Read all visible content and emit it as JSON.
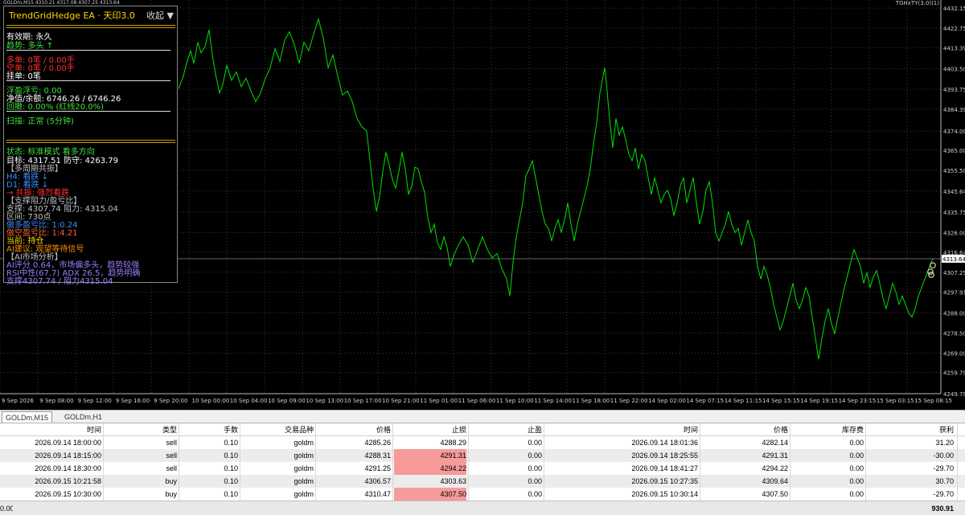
{
  "chart": {
    "symbol_header": "GOLDm,M15  4310.21 4317.08 4307.25 4313.64",
    "indicator_label": "TGHxTY(3.0)(1)",
    "price_label": "4313.64",
    "price_axis": [
      "4432.15",
      "4422.75",
      "4413.39",
      "4403.50",
      "4393.75",
      "4384.39",
      "4374.00",
      "4365.00",
      "4355.50",
      "4345.64",
      "4335.75",
      "4326.00",
      "4316.64",
      "4307.25",
      "4297.91",
      "4288.00",
      "4278.50",
      "4269.00",
      "4259.79",
      "4249.79"
    ],
    "time_axis": [
      "9 Sep 2026",
      "9 Sep 08:00",
      "9 Sep 12:00",
      "9 Sep 16:00",
      "9 Sep 20:00",
      "10 Sep 00:00",
      "10 Sep 04:00",
      "10 Sep 09:00",
      "10 Sep 13:00",
      "10 Sep 17:00",
      "10 Sep 21:00",
      "11 Sep 01:00",
      "11 Sep 06:00",
      "11 Sep 10:00",
      "11 Sep 14:00",
      "11 Sep 18:00",
      "11 Sep 22:00",
      "14 Sep 02:00",
      "14 Sep 07:15",
      "14 Sep 11:15",
      "14 Sep 15:15",
      "14 Sep 19:15",
      "14 Sep 23:15",
      "15 Sep 03:15",
      "15 Sep 08:15"
    ],
    "line_color": "#00e000",
    "grid_color": "#3a3a3a"
  },
  "ea": {
    "title": "TrendGridHedge EA · 天印3.0",
    "collapse": "收起 ▼",
    "validity": "有效期: 永久",
    "trend": "趋势: 多头 ↑",
    "long_orders": "多单: 0笔 / 0.00手",
    "short_orders": "空单: 0笔 / 0.00手",
    "pending": "挂单: 0笔",
    "floating": "浮盈浮亏: 0.00",
    "equity": "净值/余额: 6746.26 / 6746.26",
    "drawdown": "回撤: 0.00% (红线20.0%)",
    "scan": "扫描: 正常 (5分钟)",
    "status": "状态: 标准模式 看多方向",
    "target": "目标: 4317.51  防守: 4263.79",
    "resonance_hdr": "【多周期共振】",
    "h4": "H4: 看跌 ↓",
    "d1": "D1: 看跌 ↓",
    "conclusion": "→ 共振: 强烈看跌",
    "sr_hdr": "【支撑阻力/盈亏比】",
    "sr": "支撑: 4307.74  阻力: 4315.04",
    "range": "区间: 730点",
    "long_rr": "做多盈亏比: 1:0.24",
    "short_rr": "做空盈亏比: 1:4.21",
    "current": "当前: 持仓",
    "ai_advice": "AI建议: 观望等待信号",
    "ai_hdr": "【AI市场分析】",
    "ai_score": "AI评分 0.64，市场偏多头，趋势较强",
    "ai_rsi": "RSI中性(67.7)  ADX 26.5，趋势明确",
    "ai_sr": "支撑4307.74 / 阻力4315.04",
    "colors": {
      "gold": "#ffd700",
      "white": "#ffffff",
      "red": "#ff3030",
      "green": "#40e040",
      "yellow": "#ffd700",
      "blue": "#3b8cff",
      "orange": "#ff8c00",
      "purple": "#9a7cff",
      "gray": "#c0c0c0"
    }
  },
  "tabs": [
    "GOLDm,M15",
    "GOLDm,H1"
  ],
  "table": {
    "headers": [
      "时间",
      "类型",
      "手数",
      "交易品种",
      "价格",
      "止损",
      "止盈",
      "时间",
      "价格",
      "库存费",
      "获利"
    ],
    "rows": [
      {
        "open_time": "2026.09.14 18:00:00",
        "type": "sell",
        "lots": "0.10",
        "symbol": "goldm",
        "price": "4285.26",
        "sl": "4288.29",
        "tp": "0.00",
        "close_time": "2026.09.14 18:01:36",
        "close_price": "4282.14",
        "swap": "0.00",
        "profit": "31.20",
        "sl_hit": false
      },
      {
        "open_time": "2026.09.14 18:15:00",
        "type": "sell",
        "lots": "0.10",
        "symbol": "goldm",
        "price": "4288.31",
        "sl": "4291.31",
        "tp": "0.00",
        "close_time": "2026.09.14 18:25:55",
        "close_price": "4291.31",
        "swap": "0.00",
        "profit": "-30.00",
        "sl_hit": true
      },
      {
        "open_time": "2026.09.14 18:30:00",
        "type": "sell",
        "lots": "0.10",
        "symbol": "goldm",
        "price": "4291.25",
        "sl": "4294.22",
        "tp": "0.00",
        "close_time": "2026.09.14 18:41:27",
        "close_price": "4294.22",
        "swap": "0.00",
        "profit": "-29.70",
        "sl_hit": true
      },
      {
        "open_time": "2026.09.15 10:21:58",
        "type": "buy",
        "lots": "0.10",
        "symbol": "goldm",
        "price": "4306.57",
        "sl": "4303.63",
        "tp": "0.00",
        "close_time": "2026.09.15 10:27:35",
        "close_price": "4309.64",
        "swap": "0.00",
        "profit": "30.70",
        "sl_hit": false
      },
      {
        "open_time": "2026.09.15 10:30:00",
        "type": "buy",
        "lots": "0.10",
        "symbol": "goldm",
        "price": "4310.47",
        "sl": "4307.50",
        "tp": "0.00",
        "close_time": "2026.09.15 10:30:14",
        "close_price": "4307.50",
        "swap": "0.00",
        "profit": "-29.70",
        "sl_hit": true
      }
    ],
    "footer_left": "0.00",
    "footer_right": "930.91"
  }
}
